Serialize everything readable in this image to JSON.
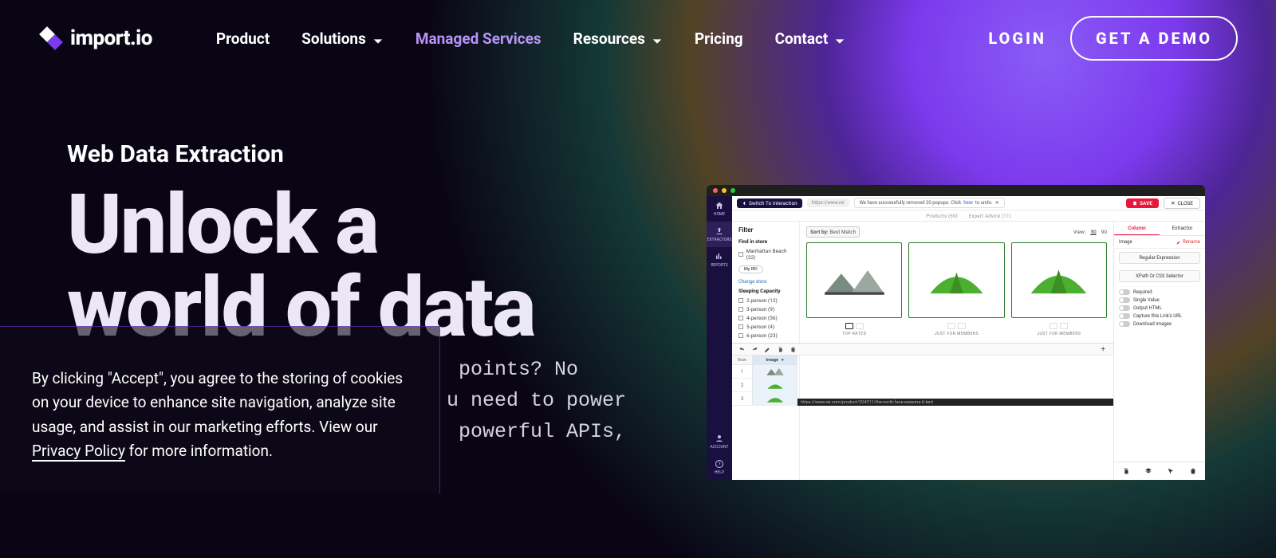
{
  "brand": {
    "name": "import.io"
  },
  "nav": {
    "items": [
      {
        "label": "Product",
        "dropdown": false
      },
      {
        "label": "Solutions",
        "dropdown": true
      },
      {
        "label": "Managed Services",
        "dropdown": false,
        "active": true
      },
      {
        "label": "Resources",
        "dropdown": true
      },
      {
        "label": "Pricing",
        "dropdown": false
      },
      {
        "label": "Contact",
        "dropdown": true
      }
    ],
    "login": "LOGIN",
    "demo": "GET A DEMO"
  },
  "hero": {
    "eyebrow": "Web Data Extraction",
    "headline_line1": "Unlock a",
    "headline_line2": "world of data",
    "subcopy": " points? No\nu need to power\n powerful APIs,"
  },
  "cookie": {
    "text_before": "By clicking \"Accept\", you agree to the storing of cookies on your device to enhance site navigation, analyze site usage, and assist in our marketing efforts. View our ",
    "link": "Privacy Policy",
    "text_after": " for more information."
  },
  "app": {
    "sidebar": [
      {
        "label": "HOME"
      },
      {
        "label": "EXTRACTORS",
        "active": true
      },
      {
        "label": "REPORTS"
      }
    ],
    "sidebar_bottom": [
      {
        "label": "ACCOUNT"
      },
      {
        "label": "HELP"
      }
    ],
    "topbar": {
      "switch": "Switch To Interaction",
      "url": "https://www.rei",
      "notice_before": "We have successfully removed 20 popups. Click ",
      "notice_link": "here",
      "notice_after": " to undo.",
      "save": "SAVE",
      "close": "CLOSE"
    },
    "tabs": {
      "products": "Products (69)",
      "advice": "Expert Advice (11)"
    },
    "filter": {
      "title": "Filter",
      "find": "Find in store",
      "store": "Manhattan Beach (22)",
      "myrei": "My REI",
      "change": "Change store",
      "capacity_title": "Sleeping Capacity",
      "caps": [
        "2-person (12)",
        "3-person (9)",
        "4-person (36)",
        "5-person (4)",
        "6-person (23)"
      ]
    },
    "sort": {
      "label": "Sort by:",
      "value": "Best Match",
      "view_label": "View:",
      "v30": "30",
      "v90": "90"
    },
    "swatches": {
      "a": "TOP RATED",
      "b": "JUST FOR MEMBERS",
      "c": "JUST FOR MEMBERS"
    },
    "right": {
      "tab_column": "Column",
      "tab_extractor": "Extractor",
      "image": "Image",
      "rename": "Rename",
      "regex": "Regular Expression",
      "xpath": "XPath Or CSS Selector",
      "checks": [
        "Required",
        "Single Value",
        "Output HTML",
        "Capture this Link's URL",
        "Download Images"
      ]
    },
    "bottom": {
      "row": "Row",
      "image": "Image",
      "rows": [
        "1",
        "2",
        "3"
      ],
      "path": "https://www.rei.com/product/204311/the-north-face-wawona-6-tent"
    }
  }
}
